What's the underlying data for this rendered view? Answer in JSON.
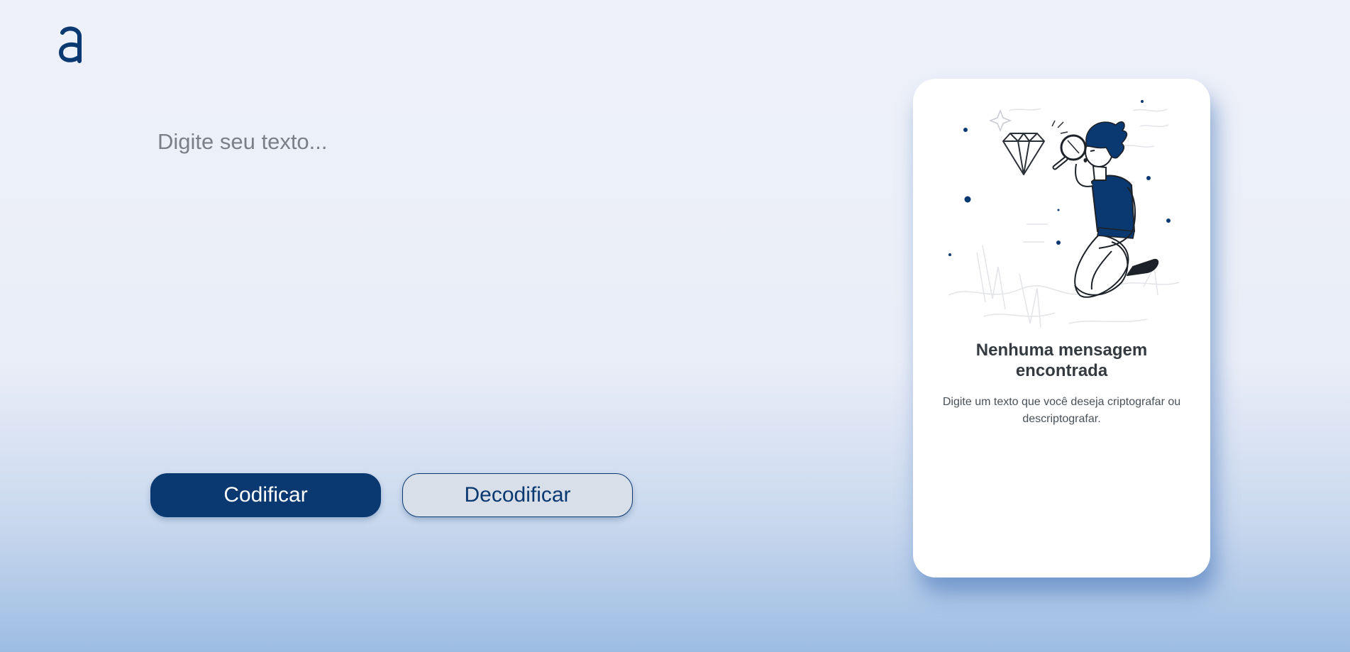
{
  "input": {
    "placeholder": "Digite seu texto...",
    "value": ""
  },
  "buttons": {
    "encode_label": "Codificar",
    "decode_label": "Decodificar"
  },
  "output_card": {
    "title": "Nenhuma mensagem encontrada",
    "subtitle": "Digite um texto que você deseja criptografar ou descriptografar."
  },
  "icons": {
    "logo": "alura-logo-icon",
    "illustration": "magnifier-diamond-illustration"
  },
  "colors": {
    "primary": "#0a3871",
    "secondary_button_bg": "#d8dfe8",
    "card_bg": "#ffffff",
    "title_text": "#343a40",
    "subtitle_text": "#495057",
    "placeholder_text": "#7b7f88"
  }
}
